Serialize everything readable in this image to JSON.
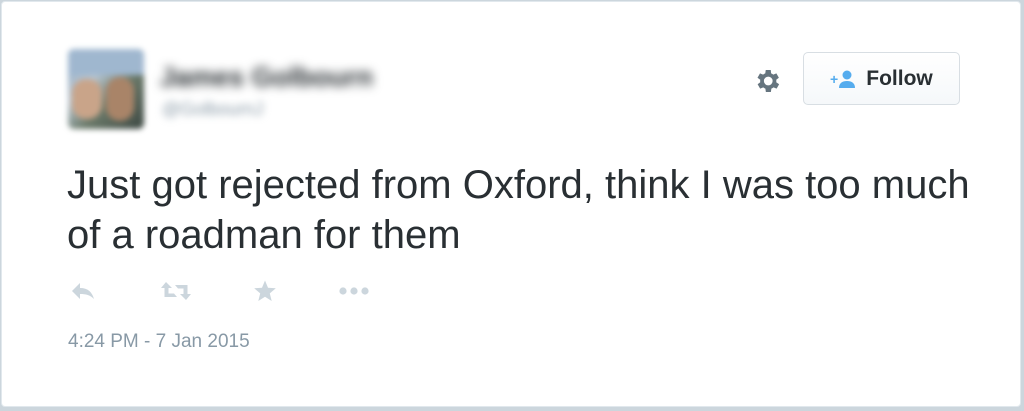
{
  "user": {
    "display_name": "James Golbourn",
    "handle": "@GolbournJ"
  },
  "follow_button": {
    "label": "Follow"
  },
  "tweet": {
    "text": "Just got rejected from Oxford, think I was too much of a roadman for them",
    "timestamp": "4:24 PM - 7 Jan 2015"
  },
  "icons": {
    "settings": "gear-icon",
    "follow": "add-user-icon",
    "reply": "reply-icon",
    "retweet": "retweet-icon",
    "favorite": "star-icon",
    "more": "more-icon"
  },
  "colors": {
    "text": "#292f33",
    "muted": "#8899a6",
    "action_icon": "#ccd6dd",
    "follow_icon": "#55acee",
    "gear": "#66757f"
  }
}
